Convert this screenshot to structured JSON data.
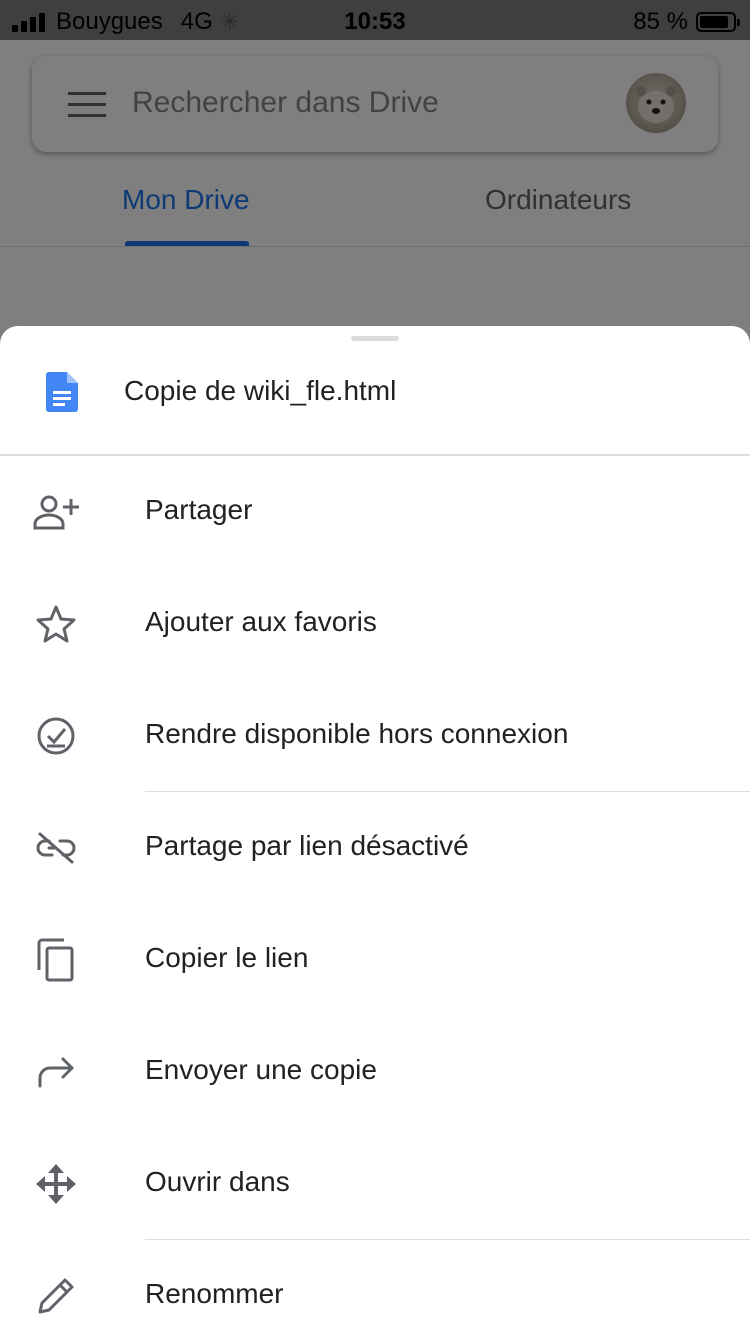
{
  "status_bar": {
    "carrier": "Bouygues",
    "network": "4G",
    "time": "10:53",
    "battery_percent": "85 %"
  },
  "search": {
    "placeholder": "Rechercher dans Drive"
  },
  "tabs": [
    {
      "label": "Mon Drive",
      "active": true
    },
    {
      "label": "Ordinateurs",
      "active": false
    }
  ],
  "sheet": {
    "file_name": "Copie de wiki_fle.html",
    "file_icon": "google-docs-icon",
    "items": [
      {
        "label": "Partager",
        "icon": "person-add-icon"
      },
      {
        "label": "Ajouter aux favoris",
        "icon": "star-outline-icon"
      },
      {
        "label": "Rendre disponible hors connexion",
        "icon": "offline-check-icon"
      },
      {
        "label": "Partage par lien désactivé",
        "icon": "link-off-icon"
      },
      {
        "label": "Copier le lien",
        "icon": "copy-icon"
      },
      {
        "label": "Envoyer une copie",
        "icon": "forward-arrow-icon"
      },
      {
        "label": "Ouvrir dans",
        "icon": "move-arrows-icon"
      },
      {
        "label": "Renommer",
        "icon": "pencil-icon"
      }
    ]
  },
  "colors": {
    "accent": "#1a73e8",
    "doc_icon": "#4285f4",
    "text_primary": "#202124",
    "icon_gray": "#5f6368"
  }
}
